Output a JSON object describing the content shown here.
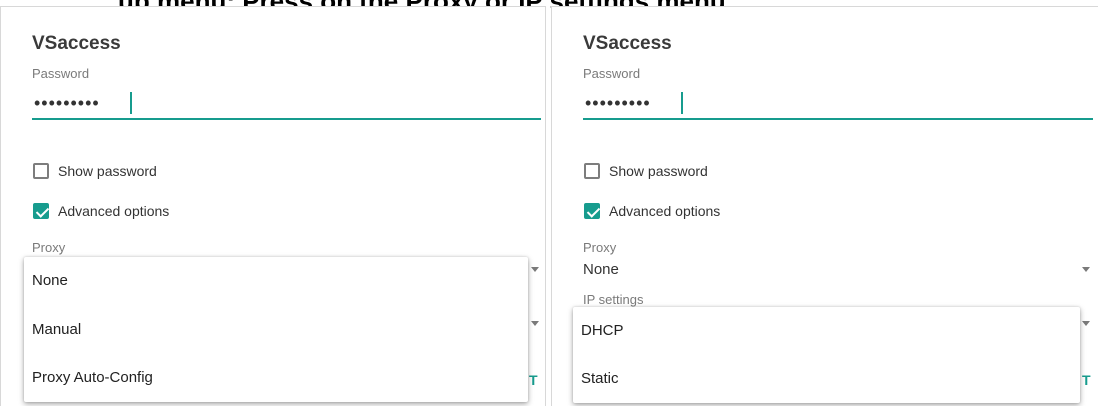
{
  "top_caption": "up menu: Press on the Proxy or IP settings menu",
  "left": {
    "title": "VSaccess",
    "password_label": "Password",
    "password_value": "•••••••••",
    "show_password_label": "Show password",
    "show_password_checked": false,
    "advanced_options_label": "Advanced options",
    "advanced_options_checked": true,
    "proxy_label": "Proxy",
    "proxy_menu": [
      "None",
      "Manual",
      "Proxy Auto-Config"
    ],
    "partial_button_text": "T"
  },
  "right": {
    "title": "VSaccess",
    "password_label": "Password",
    "password_value": "•••••••••",
    "show_password_label": "Show password",
    "show_password_checked": false,
    "advanced_options_label": "Advanced options",
    "advanced_options_checked": true,
    "proxy_label": "Proxy",
    "proxy_value": "None",
    "ip_settings_label": "IP settings",
    "ip_menu": [
      "DHCP",
      "Static"
    ],
    "partial_button_text": "T"
  },
  "colors": {
    "accent": "#179c8e",
    "text_primary": "#212121",
    "text_secondary": "#7a7a7a"
  },
  "icons": {
    "checkbox_checked": "check-icon",
    "dropdown_arrow": "triangle-down-icon"
  }
}
